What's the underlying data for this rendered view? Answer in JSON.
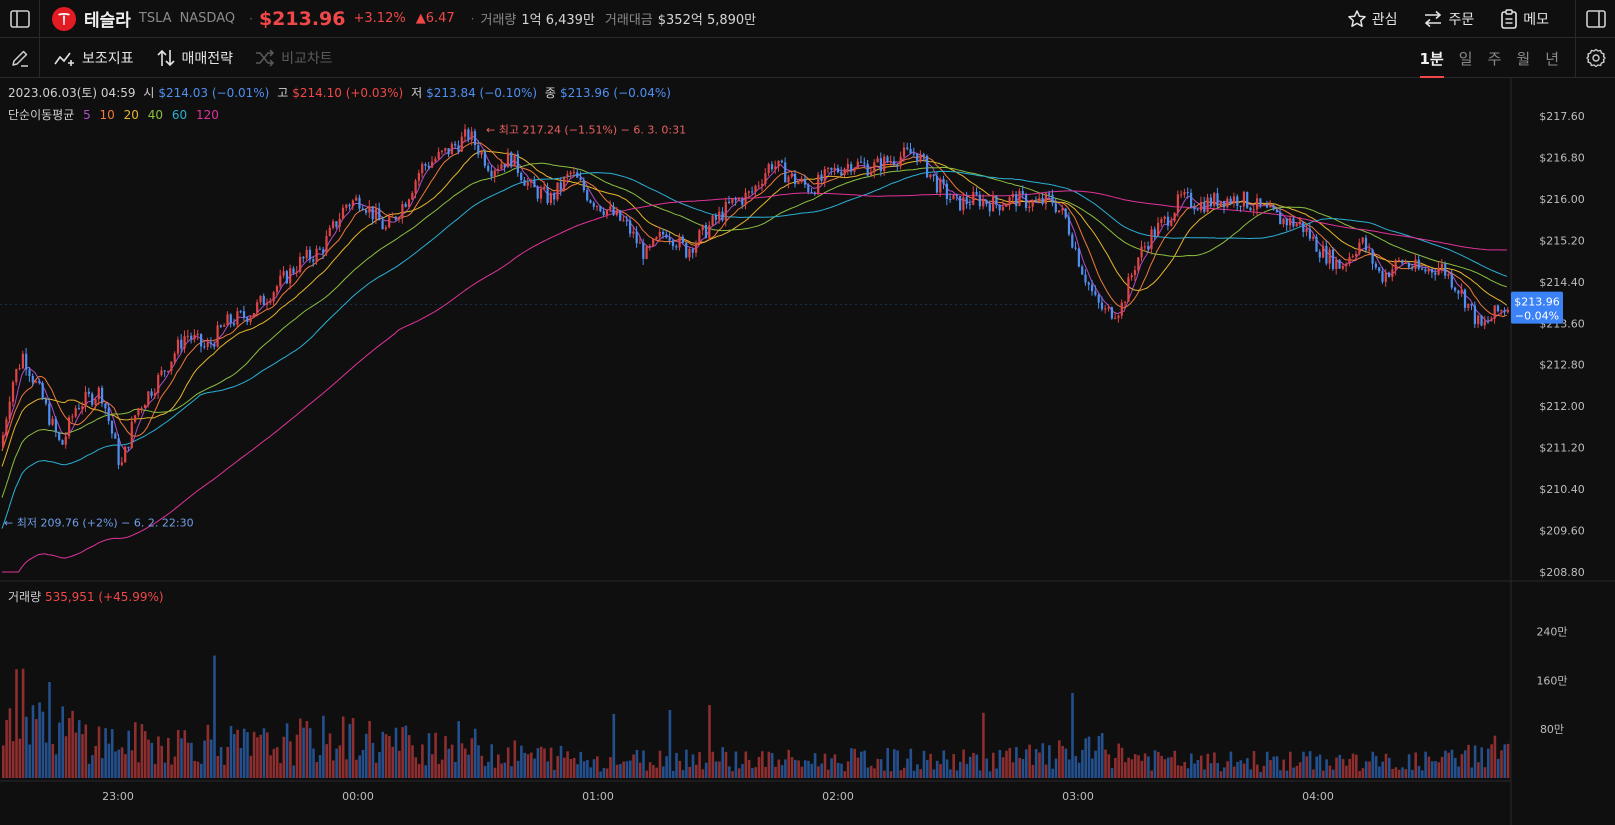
{
  "header": {
    "stock_name": "테슬라",
    "ticker": "TSLA",
    "exchange": "NASDAQ",
    "separator": "·",
    "price": "$213.96",
    "change_pct": "+3.12%",
    "change_abs": "▲6.47",
    "volume_label": "거래량",
    "volume_value": "1억 6,439만",
    "amount_label": "거래대금",
    "amount_value": "$352억 5,890만",
    "watch_label": "관심",
    "order_label": "주문",
    "memo_label": "메모"
  },
  "toolbar": {
    "indicator_label": "보조지표",
    "strategy_label": "매매전략",
    "compare_label": "비교차트",
    "timeframes": [
      "1분",
      "일",
      "주",
      "월",
      "년"
    ],
    "active_timeframe": "1분"
  },
  "ohlc": {
    "datetime": "2023.06.03(토) 04:59",
    "open_label": "시",
    "open_value": "$214.03 (−0.01%)",
    "high_label": "고",
    "high_value": "$214.10 (+0.03%)",
    "low_label": "저",
    "low_value": "$213.84 (−0.10%)",
    "close_label": "종",
    "close_value": "$213.96 (−0.04%)"
  },
  "ma_legend": {
    "label": "단순이동평균",
    "periods": [
      "5",
      "10",
      "20",
      "40",
      "60",
      "120"
    ]
  },
  "volume_legend": {
    "label": "거래량",
    "value": "535,951 (+45.99%)"
  },
  "colors": {
    "up": "#e04545",
    "down": "#4f8ff0",
    "vol_up": "#8e2e2e",
    "vol_down": "#24508e",
    "ma5": "#b04dc4",
    "ma10": "#f07a3a",
    "ma20": "#e7b52b",
    "ma40": "#8cbf3f",
    "ma60": "#2bb0d4",
    "ma120": "#e0339a",
    "current_price_bg": "#3b82f6"
  },
  "chart_data": {
    "type": "candlestick",
    "price_axis": [
      "$217.60",
      "$216.80",
      "$216.00",
      "$215.20",
      "$214.40",
      "$213.60",
      "$212.80",
      "$212.00",
      "$211.20",
      "$210.40",
      "$209.60",
      "$208.80"
    ],
    "ylim": [
      208.8,
      217.6
    ],
    "volume_axis": [
      "240만",
      "160만",
      "80만"
    ],
    "volume_ylim": [
      0,
      3000000
    ],
    "time_axis": [
      "23:00",
      "00:00",
      "01:00",
      "02:00",
      "03:00",
      "04:00"
    ],
    "current_price": "$213.96",
    "current_change": "−0.04%",
    "high_annotation": "← 최고 217.24 (−1.51%) − 6. 3. 0:31",
    "low_annotation": "← 최저 209.76 (+2%) − 6. 2. 22:30",
    "price_path": [
      [
        0,
        211.2
      ],
      [
        10,
        212.4
      ],
      [
        22,
        213.0
      ],
      [
        40,
        212.2
      ],
      [
        60,
        211.2
      ],
      [
        75,
        212.0
      ],
      [
        100,
        212.3
      ],
      [
        120,
        210.8
      ],
      [
        135,
        211.9
      ],
      [
        160,
        212.6
      ],
      [
        185,
        213.4
      ],
      [
        205,
        213.1
      ],
      [
        225,
        213.6
      ],
      [
        250,
        213.8
      ],
      [
        275,
        214.3
      ],
      [
        300,
        214.8
      ],
      [
        320,
        215.0
      ],
      [
        345,
        215.9
      ],
      [
        360,
        216.0
      ],
      [
        385,
        215.4
      ],
      [
        405,
        216.0
      ],
      [
        420,
        216.6
      ],
      [
        445,
        216.9
      ],
      [
        468,
        217.24
      ],
      [
        490,
        216.6
      ],
      [
        510,
        216.8
      ],
      [
        530,
        216.2
      ],
      [
        550,
        216.0
      ],
      [
        570,
        216.5
      ],
      [
        590,
        216.0
      ],
      [
        605,
        215.8
      ],
      [
        625,
        215.5
      ],
      [
        645,
        214.9
      ],
      [
        665,
        215.4
      ],
      [
        685,
        215.0
      ],
      [
        705,
        215.4
      ],
      [
        730,
        215.9
      ],
      [
        750,
        216.1
      ],
      [
        770,
        216.7
      ],
      [
        790,
        216.4
      ],
      [
        810,
        216.2
      ],
      [
        830,
        216.5
      ],
      [
        850,
        216.7
      ],
      [
        870,
        216.6
      ],
      [
        895,
        216.8
      ],
      [
        915,
        216.9
      ],
      [
        935,
        216.3
      ],
      [
        955,
        215.9
      ],
      [
        975,
        216.0
      ],
      [
        995,
        215.9
      ],
      [
        1015,
        216.0
      ],
      [
        1035,
        215.9
      ],
      [
        1050,
        216.0
      ],
      [
        1065,
        215.6
      ],
      [
        1080,
        214.7
      ],
      [
        1095,
        214.0
      ],
      [
        1105,
        213.8
      ],
      [
        1120,
        213.9
      ],
      [
        1135,
        214.8
      ],
      [
        1150,
        215.3
      ],
      [
        1165,
        215.6
      ],
      [
        1180,
        216.0
      ],
      [
        1200,
        215.9
      ],
      [
        1220,
        216.0
      ],
      [
        1240,
        216.0
      ],
      [
        1260,
        215.8
      ],
      [
        1280,
        215.6
      ],
      [
        1300,
        215.5
      ],
      [
        1320,
        215.0
      ],
      [
        1340,
        214.7
      ],
      [
        1360,
        215.2
      ],
      [
        1380,
        214.5
      ],
      [
        1400,
        214.8
      ],
      [
        1420,
        214.6
      ],
      [
        1440,
        214.7
      ],
      [
        1460,
        214.2
      ],
      [
        1480,
        213.5
      ],
      [
        1495,
        213.8
      ],
      [
        1510,
        213.96
      ]
    ],
    "volume_profile": [
      [
        0,
        1500000
      ],
      [
        30,
        1250000
      ],
      [
        60,
        800000
      ],
      [
        100,
        600000
      ],
      [
        150,
        550000
      ],
      [
        200,
        600000
      ],
      [
        250,
        500000
      ],
      [
        300,
        600000
      ],
      [
        350,
        650000
      ],
      [
        400,
        550000
      ],
      [
        450,
        600000
      ],
      [
        500,
        400000
      ],
      [
        550,
        350000
      ],
      [
        600,
        300000
      ],
      [
        650,
        300000
      ],
      [
        700,
        350000
      ],
      [
        750,
        300000
      ],
      [
        800,
        280000
      ],
      [
        850,
        300000
      ],
      [
        900,
        300000
      ],
      [
        950,
        280000
      ],
      [
        1000,
        320000
      ],
      [
        1050,
        360000
      ],
      [
        1100,
        450000
      ],
      [
        1150,
        300000
      ],
      [
        1200,
        250000
      ],
      [
        1250,
        280000
      ],
      [
        1300,
        270000
      ],
      [
        1350,
        280000
      ],
      [
        1400,
        250000
      ],
      [
        1450,
        300000
      ],
      [
        1510,
        535951
      ]
    ]
  }
}
